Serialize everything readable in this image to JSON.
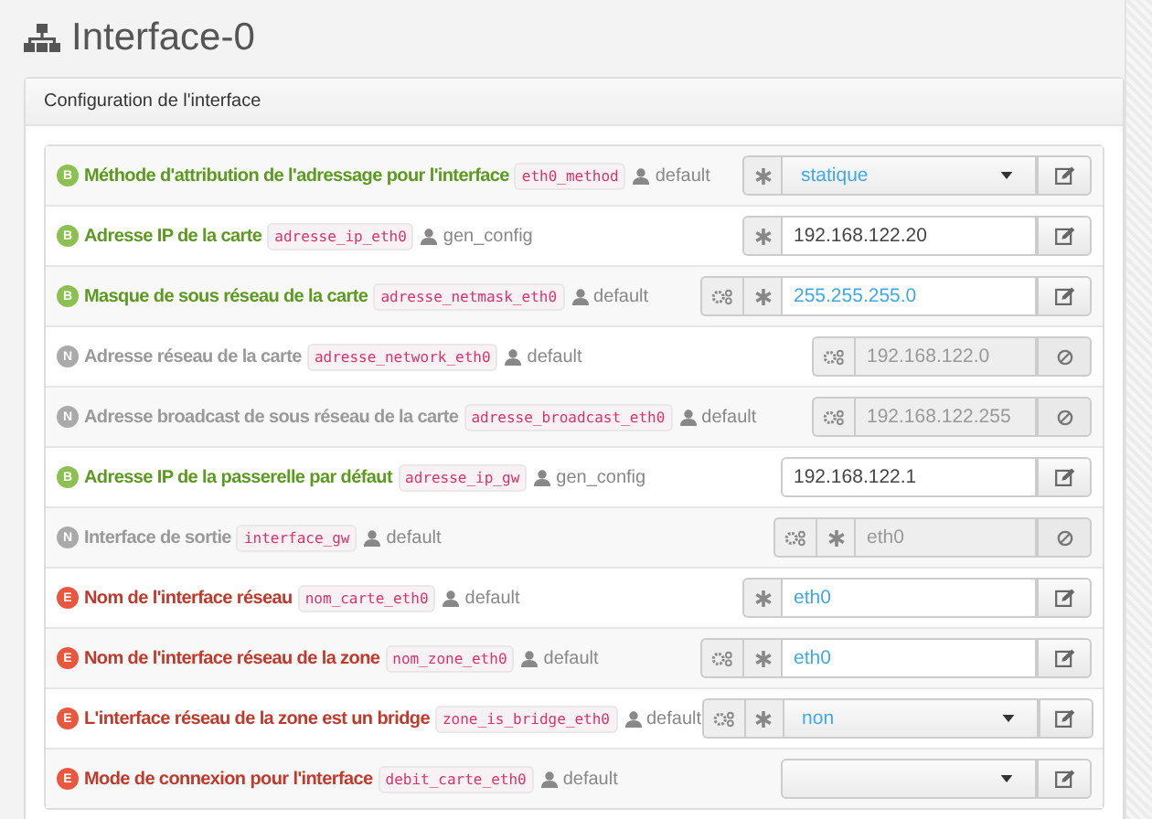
{
  "page_title": "Interface-0",
  "panel": {
    "title": "Configuration de l'interface",
    "rows": [
      {
        "level": "B",
        "label": "Méthode d'attribution de l'adressage pour l'interface",
        "variable": "eth0_method",
        "owner": "default",
        "gears": false,
        "mandatory": true,
        "kind": "select",
        "value": "statique",
        "default_value": true,
        "disabled": false
      },
      {
        "level": "B",
        "label": "Adresse IP de la carte",
        "variable": "adresse_ip_eth0",
        "owner": "gen_config",
        "gears": false,
        "mandatory": true,
        "kind": "text",
        "value": "192.168.122.20",
        "default_value": false,
        "disabled": false
      },
      {
        "level": "B",
        "label": "Masque de sous réseau de la carte",
        "variable": "adresse_netmask_eth0",
        "owner": "default",
        "gears": true,
        "mandatory": true,
        "kind": "text",
        "value": "255.255.255.0",
        "default_value": true,
        "disabled": false
      },
      {
        "level": "N",
        "label": "Adresse réseau de la carte",
        "variable": "adresse_network_eth0",
        "owner": "default",
        "gears": true,
        "mandatory": false,
        "kind": "text",
        "value": "192.168.122.0",
        "default_value": false,
        "disabled": true
      },
      {
        "level": "N",
        "label": "Adresse broadcast de sous réseau de la carte",
        "variable": "adresse_broadcast_eth0",
        "owner": "default",
        "gears": true,
        "mandatory": false,
        "kind": "text",
        "value": "192.168.122.255",
        "default_value": false,
        "disabled": true
      },
      {
        "level": "B",
        "label": "Adresse IP de la passerelle par défaut",
        "variable": "adresse_ip_gw",
        "owner": "gen_config",
        "gears": false,
        "mandatory": false,
        "kind": "text",
        "value": "192.168.122.1",
        "default_value": false,
        "disabled": false
      },
      {
        "level": "N",
        "label": "Interface de sortie",
        "variable": "interface_gw",
        "owner": "default",
        "gears": true,
        "mandatory": true,
        "kind": "text",
        "value": "eth0",
        "default_value": false,
        "disabled": true
      },
      {
        "level": "E",
        "label": "Nom de l'interface réseau",
        "variable": "nom_carte_eth0",
        "owner": "default",
        "gears": false,
        "mandatory": true,
        "kind": "text",
        "value": "eth0",
        "default_value": true,
        "disabled": false
      },
      {
        "level": "E",
        "label": "Nom de l'interface réseau de la zone",
        "variable": "nom_zone_eth0",
        "owner": "default",
        "gears": true,
        "mandatory": true,
        "kind": "text",
        "value": "eth0",
        "default_value": true,
        "disabled": false
      },
      {
        "level": "E",
        "label": "L'interface réseau de la zone est un bridge",
        "variable": "zone_is_bridge_eth0",
        "owner": "default",
        "gears": true,
        "mandatory": true,
        "kind": "select",
        "value": "non",
        "default_value": true,
        "disabled": false
      },
      {
        "level": "E",
        "label": "Mode de connexion pour l'interface",
        "variable": "debit_carte_eth0",
        "owner": "default",
        "gears": false,
        "mandatory": false,
        "kind": "select",
        "disabled": false
      }
    ]
  }
}
